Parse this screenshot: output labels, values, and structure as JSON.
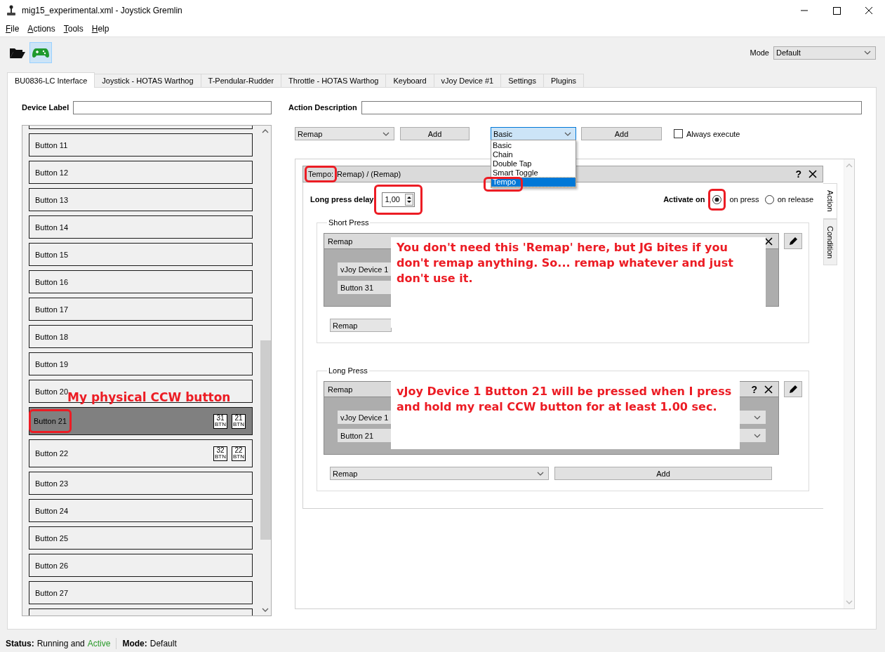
{
  "window": {
    "title": "mig15_experimental.xml - Joystick Gremlin"
  },
  "menu": [
    {
      "label": "File"
    },
    {
      "label": "Actions"
    },
    {
      "label": "Tools"
    },
    {
      "label": "Help"
    }
  ],
  "toolbar": {
    "buttons": [
      {
        "kind": "open",
        "selected": false
      },
      {
        "kind": "gamepad",
        "selected": true
      }
    ],
    "mode_label": "Mode",
    "mode_value": "Default"
  },
  "tabs": [
    {
      "label": "BU0836-LC Interface",
      "selected": true
    },
    {
      "label": "Joystick - HOTAS Warthog",
      "selected": false
    },
    {
      "label": "T-Pendular-Rudder",
      "selected": false
    },
    {
      "label": "Throttle - HOTAS Warthog",
      "selected": false
    },
    {
      "label": "Keyboard",
      "selected": false
    },
    {
      "label": "vJoy Device #1",
      "selected": false
    },
    {
      "label": "Settings",
      "selected": false
    },
    {
      "label": "Plugins",
      "selected": false
    }
  ],
  "device_label": {
    "label": "Device Label"
  },
  "inputs": [
    {
      "label": "Button 11",
      "selected": false
    },
    {
      "label": "Button 12",
      "selected": false
    },
    {
      "label": "Button 13",
      "selected": false
    },
    {
      "label": "Button 14",
      "selected": false
    },
    {
      "label": "Button 15",
      "selected": false
    },
    {
      "label": "Button 16",
      "selected": false
    },
    {
      "label": "Button 17",
      "selected": false
    },
    {
      "label": "Button 18",
      "selected": false
    },
    {
      "label": "Button 19",
      "selected": false
    },
    {
      "label": "Button 20",
      "selected": false
    },
    {
      "label": "Button 21",
      "selected": true,
      "badges": [
        {
          "number": "31",
          "unit": "BTN"
        },
        {
          "number": "21",
          "unit": "BTN"
        }
      ]
    },
    {
      "label": "Button 22",
      "selected": false,
      "badges": [
        {
          "number": "32",
          "unit": "BTN"
        },
        {
          "number": "22",
          "unit": "BTN"
        }
      ]
    },
    {
      "label": "Button 23",
      "selected": false
    },
    {
      "label": "Button 24",
      "selected": false
    },
    {
      "label": "Button 25",
      "selected": false
    },
    {
      "label": "Button 26",
      "selected": false
    },
    {
      "label": "Button 27",
      "selected": false
    }
  ],
  "action_description": {
    "label": "Action Description"
  },
  "action_bar": {
    "action_select": "Remap",
    "add_action": "Add",
    "container_select": "Basic",
    "add_container": "Add",
    "always_execute": {
      "label": "Always execute",
      "checked": false
    }
  },
  "container_dropdown": {
    "options": [
      {
        "label": "Basic",
        "selected": false
      },
      {
        "label": "Chain",
        "selected": false
      },
      {
        "label": "Double Tap",
        "selected": false
      },
      {
        "label": "Smart Toggle",
        "selected": false
      },
      {
        "label": "Tempo",
        "selected": true
      }
    ]
  },
  "container": {
    "tag": "Tempo:",
    "title": "Remap) / (Remap)",
    "help": "?",
    "long_press_delay": {
      "label": "Long press delay",
      "value": "1,00"
    },
    "activate_on": {
      "label": "Activate on",
      "options": [
        {
          "label": "on press",
          "selected": true
        },
        {
          "label": "on release",
          "selected": false
        }
      ]
    },
    "short_press": {
      "title": "Short Press",
      "action": {
        "title": "Remap",
        "device": "vJoy Device 1",
        "input": "Button 31"
      },
      "new_action": "Remap"
    },
    "long_press": {
      "title": "Long Press",
      "action": {
        "title": "Remap",
        "help": "?",
        "device": "vJoy Device 1",
        "input": "Button 21",
        "arrows": true
      },
      "new_action": "Remap",
      "add": "Add"
    }
  },
  "side_tabs": [
    {
      "label": "Action",
      "selected": true
    },
    {
      "label": "Condition",
      "selected": false
    }
  ],
  "status_bar": {
    "status_label": "Status:",
    "status_text": "Running and",
    "status_active": "Active",
    "mode_label": "Mode:",
    "mode_value": "Default"
  },
  "annotations": [
    {
      "kind": "label",
      "text": "My physical CCW button"
    },
    {
      "kind": "callout",
      "text": "You don't need this 'Remap' here, but JG bites if you don't remap anything. So... remap whatever and just don't use it."
    },
    {
      "kind": "callout",
      "text": "vJoy Device 1 Button 21 will be pressed when I press and hold my real CCW button for at least 1.00 sec."
    }
  ]
}
